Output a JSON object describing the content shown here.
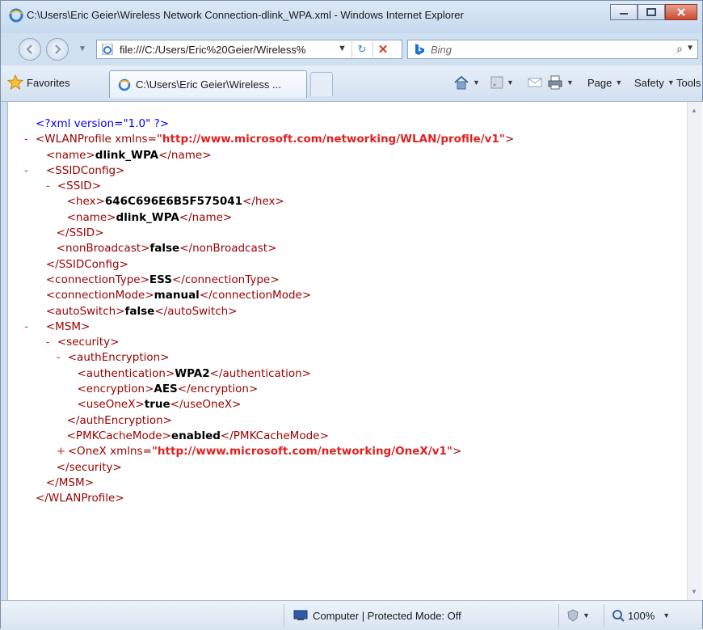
{
  "window": {
    "title": "C:\\Users\\Eric Geier\\Wireless Network Connection-dlink_WPA.xml - Windows Internet Explorer"
  },
  "navbar": {
    "address": "file:///C:/Users/Eric%20Geier/Wireless%",
    "search_placeholder": "Bing"
  },
  "favbar": {
    "favorites_label": "Favorites",
    "tab_label": "C:\\Users\\Eric Geier\\Wireless ...",
    "page_label": "Page",
    "safety_label": "Safety",
    "tools_label": "Tools"
  },
  "xml": {
    "decl": "<?xml version=\"1.0\" ?>",
    "wlan_open": "<WLANProfile xmlns=",
    "wlan_ns": "\"http://www.microsoft.com/networking/WLAN/profile/v1\"",
    "wlan_close_bracket": ">",
    "name_open": "<name>",
    "name_val": "dlink_WPA",
    "name_close": "</name>",
    "ssidconfig_open": "<SSIDConfig>",
    "ssid_open": "<SSID>",
    "hex_open": "<hex>",
    "hex_val": "646C696E6B5F575041",
    "hex_close": "</hex>",
    "ssid_name_open": "<name>",
    "ssid_name_val": "dlink_WPA",
    "ssid_name_close": "</name>",
    "ssid_close": "</SSID>",
    "nonbroadcast_open": "<nonBroadcast>",
    "nonbroadcast_val": "false",
    "nonbroadcast_close": "</nonBroadcast>",
    "ssidconfig_close": "</SSIDConfig>",
    "conntype_open": "<connectionType>",
    "conntype_val": "ESS",
    "conntype_close": "</connectionType>",
    "connmode_open": "<connectionMode>",
    "connmode_val": "manual",
    "connmode_close": "</connectionMode>",
    "autoswitch_open": "<autoSwitch>",
    "autoswitch_val": "false",
    "autoswitch_close": "</autoSwitch>",
    "msm_open": "<MSM>",
    "security_open": "<security>",
    "authenc_open": "<authEncryption>",
    "auth_open": "<authentication>",
    "auth_val": "WPA2",
    "auth_close": "</authentication>",
    "enc_open": "<encryption>",
    "enc_val": "AES",
    "enc_close": "</encryption>",
    "oneX_flag_open": "<useOneX>",
    "oneX_flag_val": "true",
    "oneX_flag_close": "</useOneX>",
    "authenc_close": "</authEncryption>",
    "pmk_open": "<PMKCacheMode>",
    "pmk_val": "enabled",
    "pmk_close": "</PMKCacheMode>",
    "onex_open": "<OneX xmlns=",
    "onex_ns": "\"http://www.microsoft.com/networking/OneX/v1\"",
    "onex_close_bracket": ">",
    "security_close": "</security>",
    "msm_close": "</MSM>",
    "wlan_close": "</WLANProfile>",
    "minus": "-",
    "plus": "+"
  },
  "status": {
    "zone_text": "Computer | Protected Mode: Off",
    "zoom": "100%"
  },
  "icons": [
    "ie-icon",
    "back-icon",
    "forward-icon",
    "refresh-icon",
    "stop-icon",
    "bing-icon",
    "search-icon",
    "star-icon",
    "home-icon",
    "feeds-icon",
    "mail-icon",
    "print-icon",
    "help-icon",
    "computer-icon"
  ],
  "colors": {
    "tag": "#990000",
    "value": "#000000",
    "namespace": "#e02020",
    "declaration": "#0000ff"
  }
}
